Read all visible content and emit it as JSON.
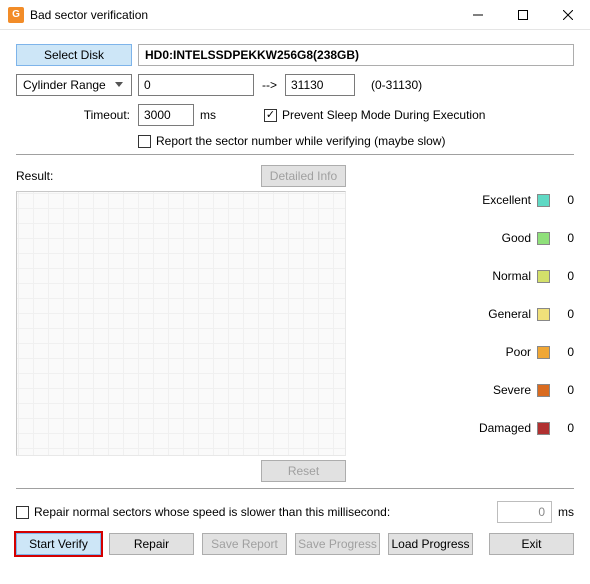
{
  "window": {
    "icon_letter": "G",
    "title": "Bad sector verification"
  },
  "toolbar": {
    "select_disk": "Select Disk",
    "disk": "HD0:INTELSSDPEKKW256G8(238GB)"
  },
  "range": {
    "mode": "Cylinder Range",
    "from": "0",
    "to": "31130",
    "hint": "(0-31130)"
  },
  "timeout": {
    "label": "Timeout:",
    "value": "3000",
    "unit": "ms"
  },
  "checks": {
    "prevent_sleep": "Prevent Sleep Mode During Execution",
    "report_sector": "Report the sector number while verifying (maybe slow)"
  },
  "result": {
    "label": "Result:",
    "detailed": "Detailed Info",
    "reset": "Reset"
  },
  "legend": [
    {
      "name": "Excellent",
      "color": "#5fd9c4",
      "value": "0"
    },
    {
      "name": "Good",
      "color": "#8fe07a",
      "value": "0"
    },
    {
      "name": "Normal",
      "color": "#d3e06a",
      "value": "0"
    },
    {
      "name": "General",
      "color": "#f0e07a",
      "value": "0"
    },
    {
      "name": "Poor",
      "color": "#f0a735",
      "value": "0"
    },
    {
      "name": "Severe",
      "color": "#d96b1f",
      "value": "0"
    },
    {
      "name": "Damaged",
      "color": "#b03030",
      "value": "0"
    }
  ],
  "repair_slow": {
    "label": "Repair normal sectors whose speed is slower than this millisecond:",
    "value": "0",
    "unit": "ms"
  },
  "buttons": {
    "start": "Start Verify",
    "repair": "Repair",
    "save_report": "Save Report",
    "save_progress": "Save Progress",
    "load_progress": "Load Progress",
    "exit": "Exit"
  }
}
